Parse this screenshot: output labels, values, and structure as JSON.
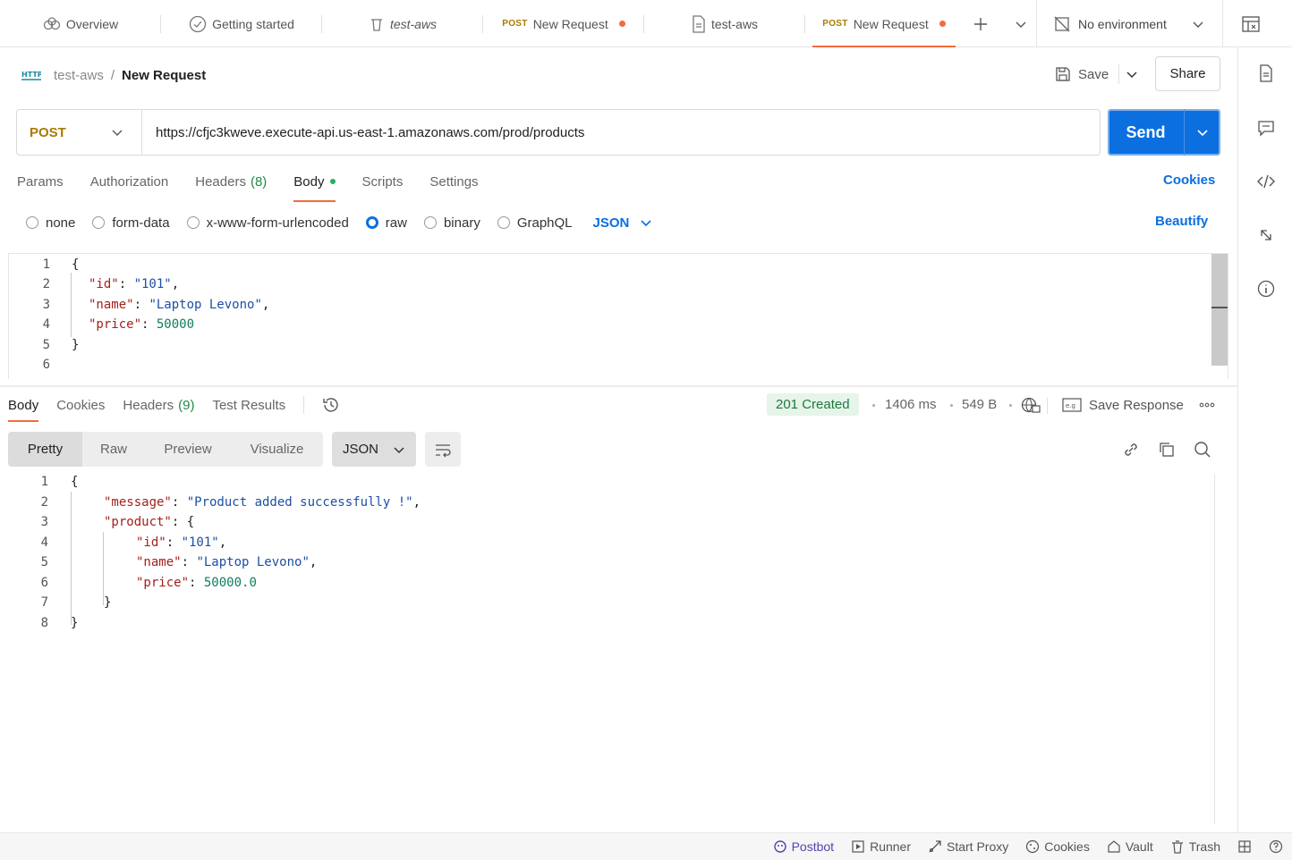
{
  "tabs": [
    {
      "label": "Overview",
      "icon": "overview-icon"
    },
    {
      "label": "Getting started",
      "icon": "check-circle-icon"
    },
    {
      "label": "test-aws",
      "icon": "trash-icon",
      "italic": true
    },
    {
      "method": "POST",
      "label": "New Request",
      "unsaved": true
    },
    {
      "label": "test-aws",
      "icon": "document-icon"
    },
    {
      "method": "POST",
      "label": "New Request",
      "unsaved": true,
      "active": true
    }
  ],
  "environment": {
    "label": "No environment"
  },
  "breadcrumb": {
    "parent": "test-aws",
    "separator": "/",
    "current": "New Request"
  },
  "header": {
    "save_label": "Save",
    "share_label": "Share"
  },
  "request": {
    "method": "POST",
    "url": "https://cfjc3kweve.execute-api.us-east-1.amazonaws.com/prod/products",
    "send_label": "Send",
    "tabs": [
      {
        "label": "Params"
      },
      {
        "label": "Authorization"
      },
      {
        "label": "Headers",
        "count": "(8)"
      },
      {
        "label": "Body",
        "active": true
      },
      {
        "label": "Scripts"
      },
      {
        "label": "Settings"
      }
    ],
    "cookies_label": "Cookies",
    "body_types": [
      "none",
      "form-data",
      "x-www-form-urlencoded",
      "raw",
      "binary",
      "GraphQL"
    ],
    "body_type_selected": "raw",
    "format": "JSON",
    "beautify_label": "Beautify",
    "line_numbers": [
      "1",
      "2",
      "3",
      "4",
      "5",
      "6"
    ],
    "code": {
      "open": "{",
      "l2_key": "\"id\"",
      "l2_val": "\"101\"",
      "l3_key": "\"name\"",
      "l3_val": "\"Laptop Levono\"",
      "l4_key": "\"price\"",
      "l4_val": "50000",
      "close": "}"
    }
  },
  "response": {
    "tabs": [
      {
        "label": "Body",
        "active": true
      },
      {
        "label": "Cookies"
      },
      {
        "label": "Headers",
        "count": "(9)"
      },
      {
        "label": "Test Results"
      }
    ],
    "status": "201 Created",
    "time": "1406 ms",
    "size": "549 B",
    "save_response_label": "Save Response",
    "views": [
      "Pretty",
      "Raw",
      "Preview",
      "Visualize"
    ],
    "view_selected": "Pretty",
    "format": "JSON",
    "line_numbers": [
      "1",
      "2",
      "3",
      "4",
      "5",
      "6",
      "7",
      "8"
    ],
    "code": {
      "open": "{",
      "message_key": "\"message\"",
      "message_val": "\"Product added successfully !\"",
      "product_key": "\"product\"",
      "product_open": "{",
      "id_key": "\"id\"",
      "id_val": "\"101\"",
      "name_key": "\"name\"",
      "name_val": "\"Laptop Levono\"",
      "price_key": "\"price\"",
      "price_val": "50000.0",
      "inner_close": "}",
      "close": "}"
    }
  },
  "footer": [
    {
      "label": "Postbot",
      "icon": "postbot-icon"
    },
    {
      "label": "Runner",
      "icon": "runner-icon"
    },
    {
      "label": "Start Proxy",
      "icon": "proxy-icon"
    },
    {
      "label": "Cookies",
      "icon": "cookie-icon"
    },
    {
      "label": "Vault",
      "icon": "vault-icon"
    },
    {
      "label": "Trash",
      "icon": "trash-icon"
    }
  ],
  "colors": {
    "accent": "#f26b3a",
    "primary": "#0b6fe0",
    "method_post": "#a67b00",
    "status_ok": "#1b7b3a"
  }
}
